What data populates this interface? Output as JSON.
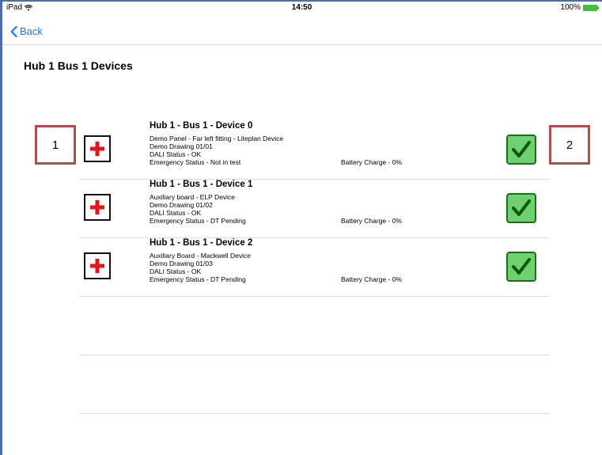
{
  "status_bar": {
    "device": "iPad",
    "time": "14:50",
    "battery": "100%"
  },
  "nav": {
    "back_label": "Back"
  },
  "page_title": "Hub 1 Bus 1 Devices",
  "callouts": [
    "1",
    "2"
  ],
  "devices": [
    {
      "title": "Hub 1 - Bus 1 - Device 0",
      "description": "Demo Panel - Far left fitting - Liteplan Device",
      "drawing": "Demo Drawing 01/01",
      "dali_status": "DALI Status - OK",
      "emergency_status": "Emergency Status - Not in test",
      "battery_charge": "Battery Charge - 0%"
    },
    {
      "title": "Hub 1 - Bus 1 - Device 1",
      "description": "Auxiliary board - ELP Device",
      "drawing": "Demo Drawing 01/02",
      "dali_status": "DALI Status - OK",
      "emergency_status": "Emergency Status -  DT Pending",
      "battery_charge": "Battery Charge - 0%"
    },
    {
      "title": "Hub 1 - Bus 1 - Device 2",
      "description": "Auxiliary Board - Mackwell Device",
      "drawing": "Demo Drawing 01/03",
      "dali_status": "DALI Status - OK",
      "emergency_status": "Emergency Status -  DT Pending",
      "battery_charge": "Battery Charge - 0%"
    }
  ],
  "icons": {
    "add": "plus-icon",
    "status": "checkmark-icon",
    "back": "chevron-left-icon",
    "wifi": "wifi-icon",
    "battery": "battery-icon"
  },
  "colors": {
    "accent": "#1a7cf5",
    "plus_red": "#e3141b",
    "check_green": "#6fd06f",
    "callout_border": "#b54a4a"
  }
}
